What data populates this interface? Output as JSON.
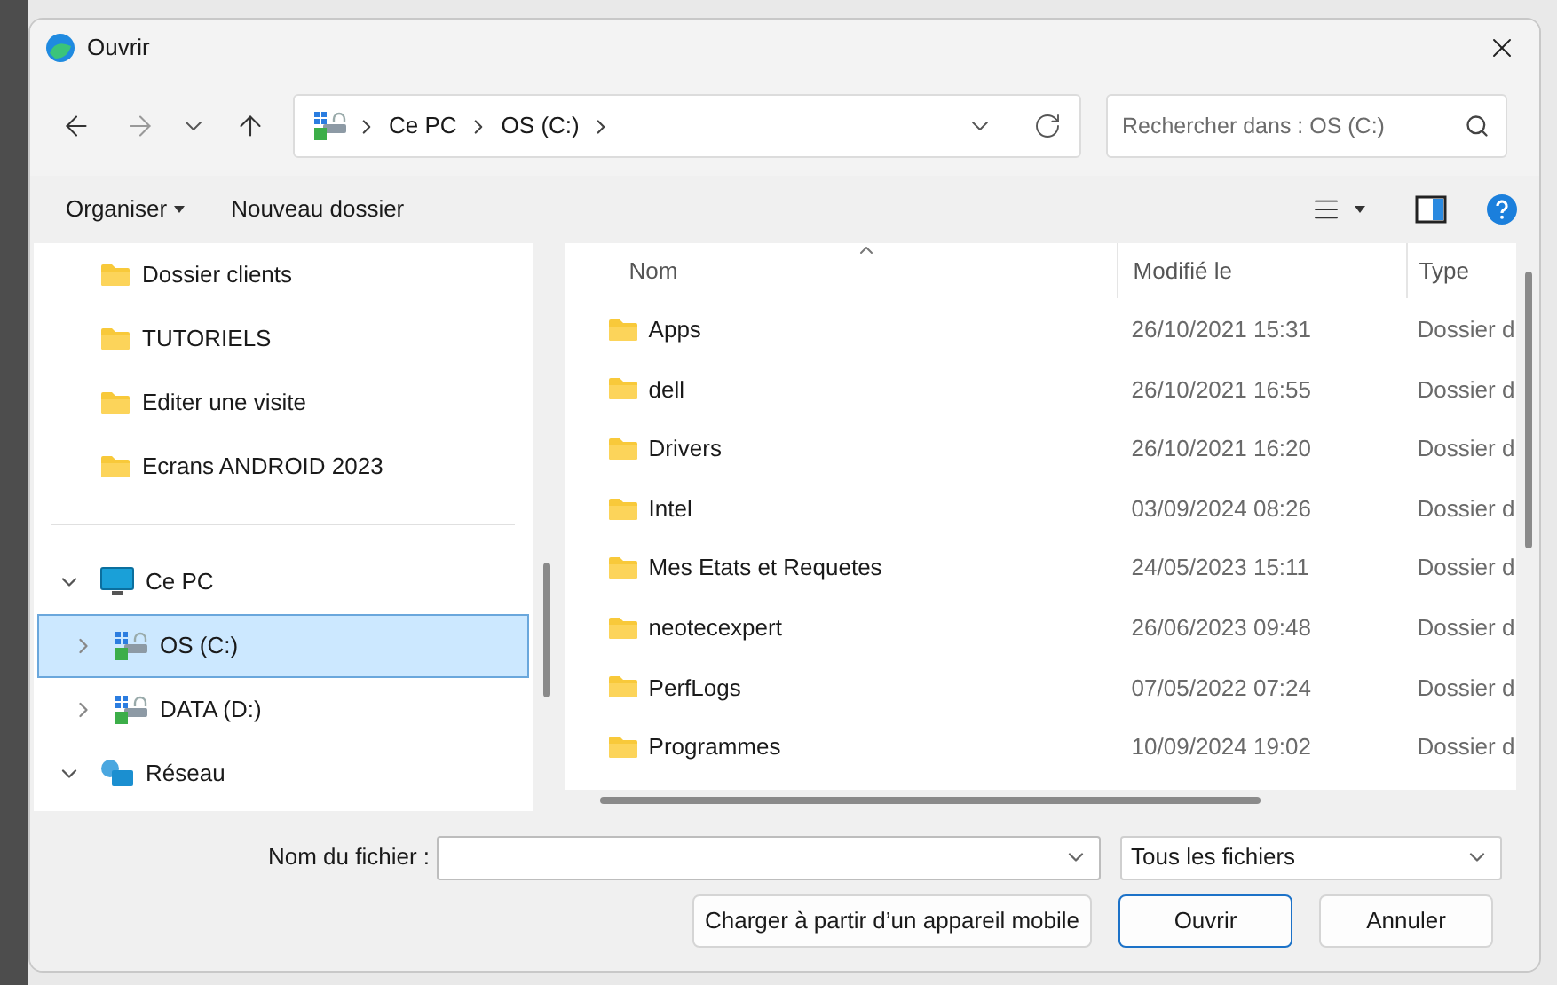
{
  "window": {
    "title": "Ouvrir"
  },
  "address_bar": {
    "segments": [
      "Ce PC",
      "OS (C:)"
    ]
  },
  "search": {
    "placeholder": "Rechercher dans : OS (C:)"
  },
  "toolbar": {
    "organize": "Organiser",
    "new_folder": "Nouveau dossier"
  },
  "nav_pane": {
    "quick_access": [
      {
        "label": "Dossier clients"
      },
      {
        "label": "TUTORIELS"
      },
      {
        "label": "Editer une visite"
      },
      {
        "label": "Ecrans ANDROID 2023"
      }
    ],
    "tree": [
      {
        "label": "Ce PC",
        "kind": "pc",
        "expanded": true,
        "selected": false,
        "children": [
          {
            "label": "OS (C:)",
            "kind": "drive",
            "expanded": false,
            "selected": true
          },
          {
            "label": "DATA (D:)",
            "kind": "drive",
            "expanded": false,
            "selected": false
          }
        ]
      },
      {
        "label": "Réseau",
        "kind": "network",
        "expanded": true,
        "selected": false
      }
    ]
  },
  "file_list": {
    "columns": [
      "Nom",
      "Modifié le",
      "Type"
    ],
    "rows": [
      {
        "name": "Apps",
        "modified": "26/10/2021 15:31",
        "type": "Dossier d"
      },
      {
        "name": "dell",
        "modified": "26/10/2021 16:55",
        "type": "Dossier d"
      },
      {
        "name": "Drivers",
        "modified": "26/10/2021 16:20",
        "type": "Dossier d"
      },
      {
        "name": "Intel",
        "modified": "03/09/2024 08:26",
        "type": "Dossier d"
      },
      {
        "name": "Mes Etats et Requetes",
        "modified": "24/05/2023 15:11",
        "type": "Dossier d"
      },
      {
        "name": "neotecexpert",
        "modified": "26/06/2023 09:48",
        "type": "Dossier d"
      },
      {
        "name": "PerfLogs",
        "modified": "07/05/2022 07:24",
        "type": "Dossier d"
      },
      {
        "name": "Programmes",
        "modified": "10/09/2024 19:02",
        "type": "Dossier d"
      }
    ]
  },
  "footer": {
    "filename_label": "Nom du fichier :",
    "file_type": "Tous les fichiers",
    "buttons": [
      {
        "label": "Charger à partir d’un appareil mobile",
        "default": false
      },
      {
        "label": "Ouvrir",
        "default": true
      },
      {
        "label": "Annuler",
        "default": false
      }
    ]
  }
}
